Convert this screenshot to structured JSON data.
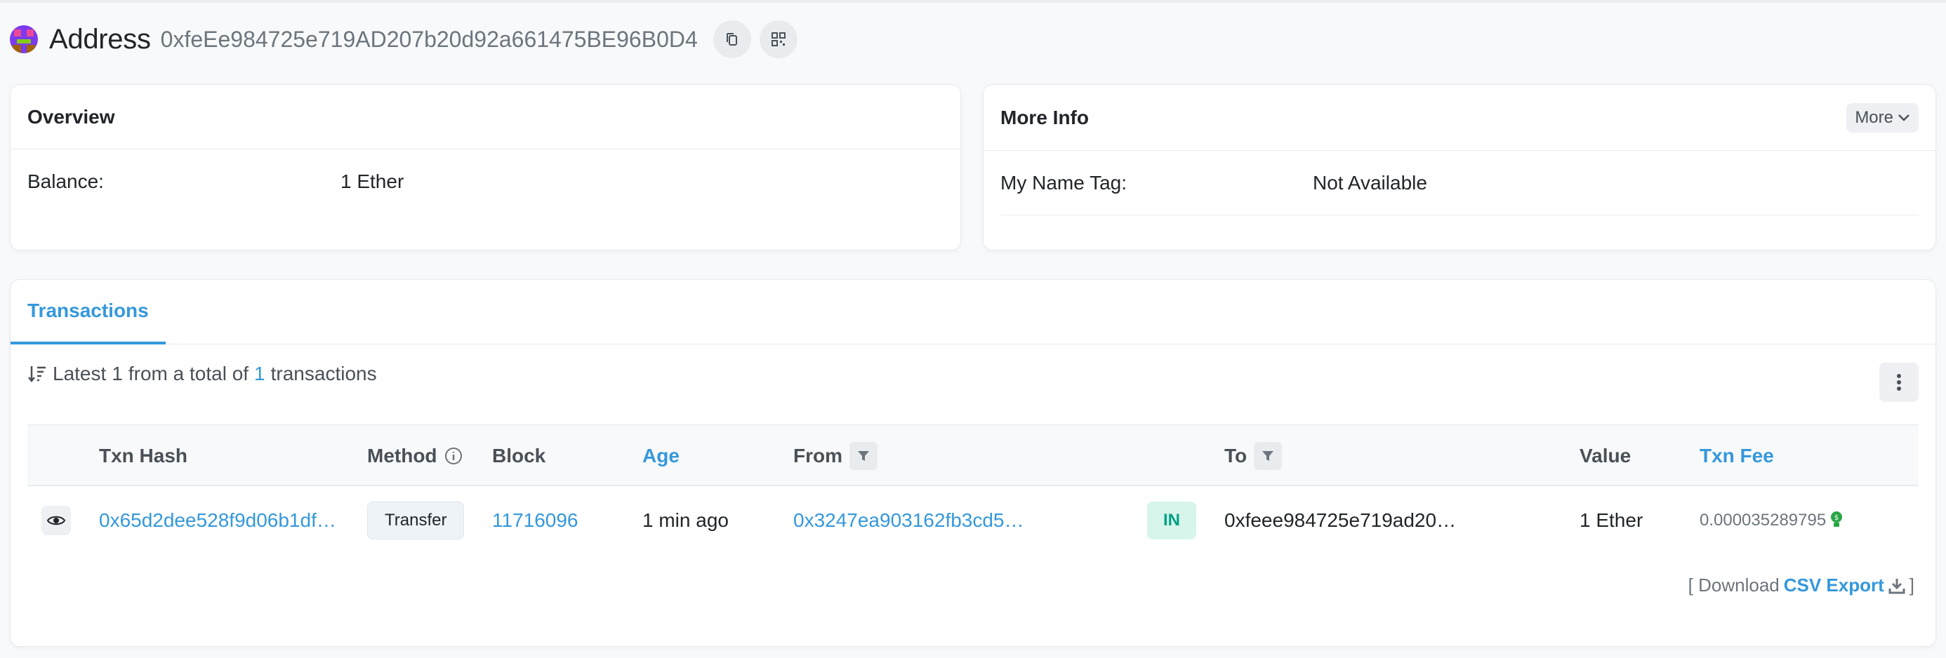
{
  "header": {
    "title": "Address",
    "address": "0xfeEe984725e719AD207b20d92a661475BE96B0D4",
    "copy_icon": "copy-icon",
    "qr_icon": "qr-code-icon",
    "avatar_colors": [
      "#7c3aed",
      "#ec4899",
      "#84cc16",
      "#a16207"
    ]
  },
  "overview": {
    "title": "Overview",
    "balance_label": "Balance:",
    "balance_value": "1 Ether"
  },
  "more_info": {
    "title": "More Info",
    "more_button": "More",
    "name_tag_label": "My Name Tag:",
    "name_tag_value": "Not Available"
  },
  "transactions": {
    "tab_label": "Transactions",
    "summary": {
      "prefix": "Latest",
      "count": "1",
      "middle": "from a total of",
      "total": "1",
      "suffix": "transactions"
    },
    "columns": {
      "txn_hash": "Txn Hash",
      "method": "Method",
      "block": "Block",
      "age": "Age",
      "from": "From",
      "to": "To",
      "value": "Value",
      "txn_fee": "Txn Fee"
    },
    "rows": [
      {
        "txn_hash": "0x65d2dee528f9d06b1df…",
        "method": "Transfer",
        "block": "11716096",
        "age": "1 min ago",
        "from": "0x3247ea903162fb3cd5…",
        "direction": "IN",
        "to": "0xfeee984725e719ad20…",
        "value": "1 Ether",
        "txn_fee": "0.000035289795"
      }
    ],
    "download": {
      "open_bracket": "[ Download",
      "link": "CSV Export",
      "close_bracket": "]"
    }
  },
  "colors": {
    "accent": "#3498db",
    "in_badge_bg": "#d7f5ea",
    "in_badge_text": "#00a186"
  }
}
